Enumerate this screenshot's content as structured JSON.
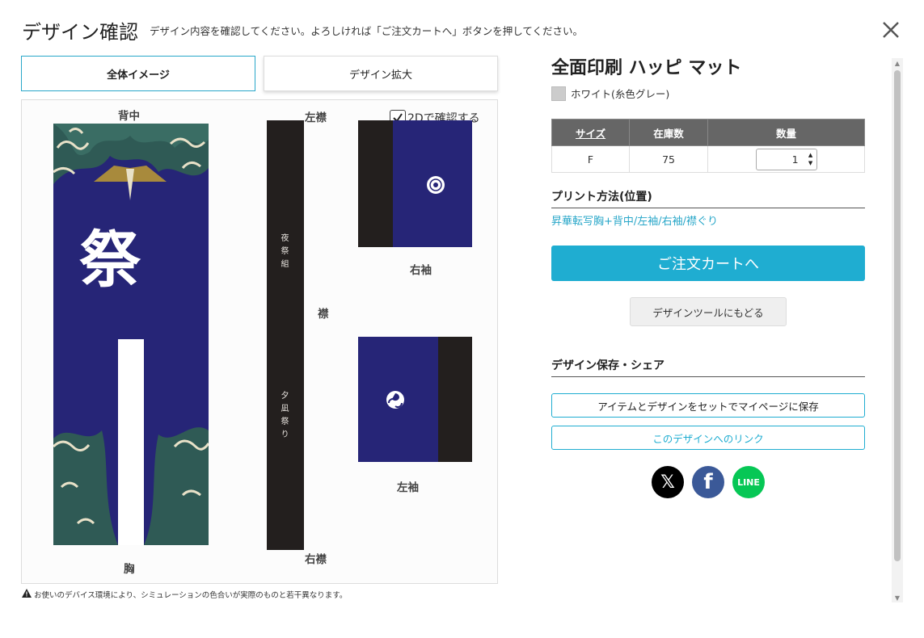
{
  "header": {
    "title": "デザイン確認",
    "description": "デザイン内容を確認してください。よろしければ「ご注文カートへ」ボタンを押してください。"
  },
  "tabs": [
    {
      "label": "全体イメージ",
      "active": true
    },
    {
      "label": "デザイン拡大",
      "active": false
    }
  ],
  "preview": {
    "check_label": "2Dで確認する",
    "checked": true,
    "labels": {
      "back": "背中",
      "chest": "胸",
      "left_collar": "左襟",
      "collar": "襟",
      "right_collar": "右襟",
      "right_sleeve": "右袖",
      "left_sleeve": "左袖"
    },
    "collar_text_top": "夜祭組",
    "collar_text_bottom": "夕凪祭り",
    "back_emblem": "祭",
    "colors": {
      "navy": "#262577",
      "black": "#231f1e",
      "gold": "#a88a3c"
    }
  },
  "warning": "お使いのデバイス環境により、シミュレーションの色合いが実際のものと若干異なります。",
  "product": {
    "title": "全面印刷 ハッピ マット",
    "color_label": "ホワイト(糸色グレー)",
    "color_swatch": "#cccccc"
  },
  "stock_table": {
    "headers": {
      "size": "サイズ",
      "stock": "在庫数",
      "qty": "数量"
    },
    "rows": [
      {
        "size": "F",
        "stock": "75",
        "qty": "1"
      }
    ]
  },
  "print_method": {
    "heading": "プリント方法(位置)",
    "value": "昇華転写胸+背中/左袖/右袖/襟ぐり"
  },
  "buttons": {
    "cart": "ご注文カートへ",
    "back_to_tool": "デザインツールにもどる",
    "save_mypage": "アイテムとデザインをセットでマイページに保存",
    "design_link": "このデザインへのリンク"
  },
  "share": {
    "heading": "デザイン保存・シェア",
    "x_label": "𝕏",
    "facebook_label": "f",
    "line_label": "LINE",
    "colors": {
      "x": "#000000",
      "facebook": "#3b5998",
      "line": "#06c755"
    }
  },
  "accent_color": "#1fadd1"
}
